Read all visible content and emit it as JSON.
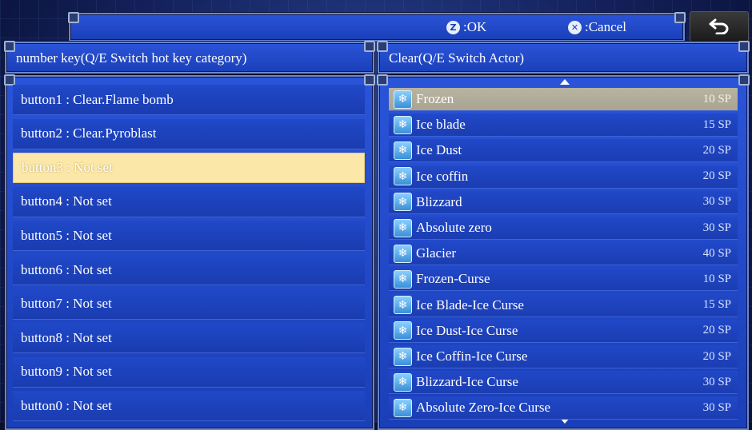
{
  "hints": {
    "ok_glyph": "Z",
    "ok_label": ":OK",
    "cancel_glyph": "✕",
    "cancel_label": ":Cancel"
  },
  "back_icon": "return-arrow-icon",
  "left_panel": {
    "header": "number key(Q/E Switch hot key category)",
    "selected_index": 2,
    "rows": [
      "button1 : Clear.Flame bomb",
      "button2 : Clear.Pyroblast",
      "button3 : Not set",
      "button4 : Not set",
      "button5 : Not set",
      "button6 : Not set",
      "button7 : Not set",
      "button8 : Not set",
      "button9 : Not set",
      "button0 : Not set"
    ]
  },
  "right_panel": {
    "header": "Clear(Q/E Switch Actor)",
    "selected_index": 0,
    "skill_icon": "snowflake-icon",
    "skills": [
      {
        "name": "Frozen",
        "cost": "10 SP"
      },
      {
        "name": "Ice blade",
        "cost": "15 SP"
      },
      {
        "name": "Ice Dust",
        "cost": "20 SP"
      },
      {
        "name": "Ice coffin",
        "cost": "20 SP"
      },
      {
        "name": "Blizzard",
        "cost": "30 SP"
      },
      {
        "name": "Absolute zero",
        "cost": "30 SP"
      },
      {
        "name": "Glacier",
        "cost": "40 SP"
      },
      {
        "name": "Frozen-Curse",
        "cost": "10 SP"
      },
      {
        "name": "Ice Blade-Ice Curse",
        "cost": "15 SP"
      },
      {
        "name": "Ice Dust-Ice Curse",
        "cost": "20 SP"
      },
      {
        "name": "Ice Coffin-Ice Curse",
        "cost": "20 SP"
      },
      {
        "name": "Blizzard-Ice Curse",
        "cost": "30 SP"
      },
      {
        "name": "Absolute Zero-Ice Curse",
        "cost": "30 SP"
      }
    ]
  },
  "colors": {
    "panel_blue": "#1a3fb8",
    "highlight_yellow": "#fbe7a8",
    "highlight_gray": "#b9b3a2"
  }
}
